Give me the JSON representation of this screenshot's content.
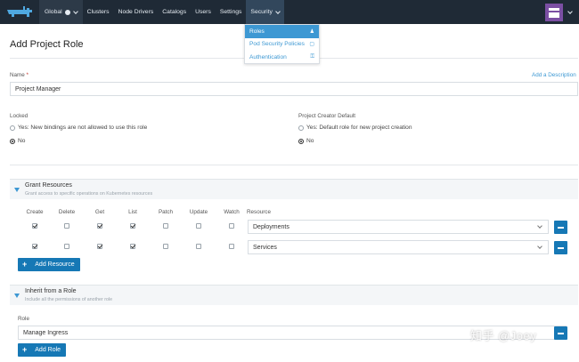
{
  "nav": {
    "items": [
      {
        "label": "Global"
      },
      {
        "label": "Clusters"
      },
      {
        "label": "Node Drivers"
      },
      {
        "label": "Catalogs"
      },
      {
        "label": "Users"
      },
      {
        "label": "Settings"
      },
      {
        "label": "Security"
      }
    ]
  },
  "security_menu": {
    "items": [
      {
        "label": "Roles",
        "icon": "user-icon"
      },
      {
        "label": "Pod Security Policies",
        "icon": "policy-icon"
      },
      {
        "label": "Authentication",
        "icon": "key-icon"
      }
    ]
  },
  "page": {
    "title": "Add Project Role",
    "name_label": "Name",
    "required_mark": "*",
    "add_description": "Add a Description",
    "name_value": "Project Manager",
    "locked_label": "Locked",
    "locked_yes": "Yes: New bindings are not allowed to use this role",
    "locked_no": "No",
    "locked_selected": "No",
    "creator_label": "Project Creator Default",
    "creator_yes": "Yes: Default role for new project creation",
    "creator_no": "No",
    "creator_selected": "No"
  },
  "grant": {
    "title": "Grant Resources",
    "subtitle": "Grant access to specific operations on Kubernetes resources",
    "columns": [
      "Create",
      "Delete",
      "Get",
      "List",
      "Patch",
      "Update",
      "Watch",
      "Resource"
    ],
    "rows": [
      {
        "resource": "Deployments",
        "checks": [
          true,
          false,
          true,
          true,
          false,
          false,
          false
        ]
      },
      {
        "resource": "Services",
        "checks": [
          true,
          false,
          true,
          true,
          false,
          false,
          false
        ]
      }
    ],
    "add_button": "Add Resource"
  },
  "inherit": {
    "title": "Inherit from a Role",
    "subtitle": "Include all the permissions of another role",
    "role_label": "Role",
    "role_value": "Manage Ingress",
    "add_button": "Add Role"
  },
  "watermark": "知乎 @Joey",
  "colors": {
    "nav_bg": "#1f2a36",
    "accent": "#3d98d3",
    "button": "#1678b5",
    "avatar": "#7b4fa3"
  }
}
